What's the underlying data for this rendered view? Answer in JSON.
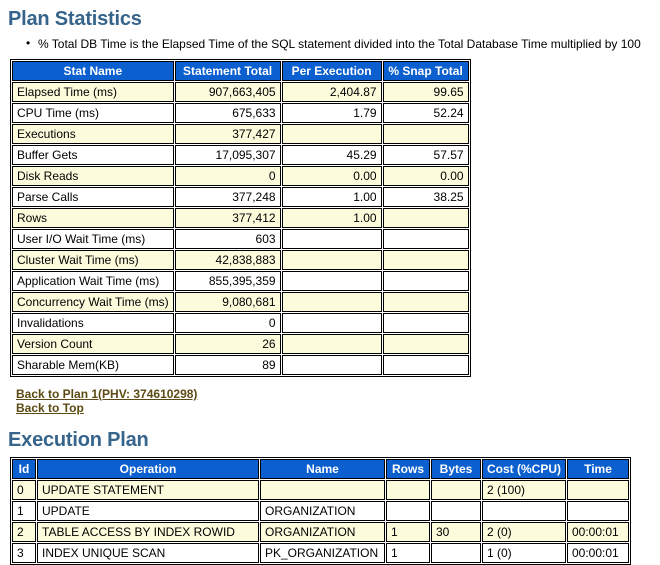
{
  "plan_statistics": {
    "title": "Plan Statistics",
    "notes": [
      "% Total DB Time is the Elapsed Time of the SQL statement divided into the Total Database Time multiplied by 100"
    ],
    "columns": [
      "Stat Name",
      "Statement Total",
      "Per Execution",
      "% Snap Total"
    ],
    "rows": [
      {
        "name": "Elapsed Time (ms)",
        "statement_total": "907,663,405",
        "per_execution": "2,404.87",
        "snap_total": "99.65"
      },
      {
        "name": "CPU Time (ms)",
        "statement_total": "675,633",
        "per_execution": "1.79",
        "snap_total": "52.24"
      },
      {
        "name": "Executions",
        "statement_total": "377,427",
        "per_execution": "",
        "snap_total": ""
      },
      {
        "name": "Buffer Gets",
        "statement_total": "17,095,307",
        "per_execution": "45.29",
        "snap_total": "57.57"
      },
      {
        "name": "Disk Reads",
        "statement_total": "0",
        "per_execution": "0.00",
        "snap_total": "0.00"
      },
      {
        "name": "Parse Calls",
        "statement_total": "377,248",
        "per_execution": "1.00",
        "snap_total": "38.25"
      },
      {
        "name": "Rows",
        "statement_total": "377,412",
        "per_execution": "1.00",
        "snap_total": ""
      },
      {
        "name": "User I/O Wait Time (ms)",
        "statement_total": "603",
        "per_execution": "",
        "snap_total": ""
      },
      {
        "name": "Cluster Wait Time (ms)",
        "statement_total": "42,838,883",
        "per_execution": "",
        "snap_total": ""
      },
      {
        "name": "Application Wait Time (ms)",
        "statement_total": "855,395,359",
        "per_execution": "",
        "snap_total": ""
      },
      {
        "name": "Concurrency Wait Time (ms)",
        "statement_total": "9,080,681",
        "per_execution": "",
        "snap_total": ""
      },
      {
        "name": "Invalidations",
        "statement_total": "0",
        "per_execution": "",
        "snap_total": ""
      },
      {
        "name": "Version Count",
        "statement_total": "26",
        "per_execution": "",
        "snap_total": ""
      },
      {
        "name": "Sharable Mem(KB)",
        "statement_total": "89",
        "per_execution": "",
        "snap_total": ""
      }
    ]
  },
  "links": [
    {
      "label": "Back to Plan 1(PHV: 374610298)",
      "name": "back-to-plan-1-link"
    },
    {
      "label": "Back to Top",
      "name": "back-to-top-link"
    }
  ],
  "execution_plan": {
    "title": "Execution Plan",
    "columns": [
      "Id",
      "Operation",
      "Name",
      "Rows",
      "Bytes",
      "Cost (%CPU)",
      "Time"
    ],
    "rows": [
      {
        "id": "0",
        "operation": "UPDATE STATEMENT",
        "indent": 0,
        "name": "",
        "rows": "",
        "bytes": "",
        "cost": "2 (100)",
        "time": ""
      },
      {
        "id": "1",
        "operation": "UPDATE",
        "indent": 1,
        "name": "ORGANIZATION",
        "rows": "",
        "bytes": "",
        "cost": "",
        "time": ""
      },
      {
        "id": "2",
        "operation": "TABLE ACCESS BY INDEX ROWID",
        "indent": 2,
        "name": "ORGANIZATION",
        "rows": "1",
        "bytes": "30",
        "cost": "2 (0)",
        "time": "00:00:01"
      },
      {
        "id": "3",
        "operation": "INDEX UNIQUE SCAN",
        "indent": 3,
        "name": "PK_ORGANIZATION",
        "rows": "1",
        "bytes": "",
        "cost": "1 (0)",
        "time": "00:00:01"
      }
    ]
  },
  "colors": {
    "heading": "#36648B",
    "table_header_bg": "#0B5FCE",
    "table_header_fg": "#FFFFFF",
    "row_odd_bg": "#FCFCDD",
    "row_even_bg": "#FFFFFF",
    "link": "#5C4A14",
    "border": "#000000"
  }
}
